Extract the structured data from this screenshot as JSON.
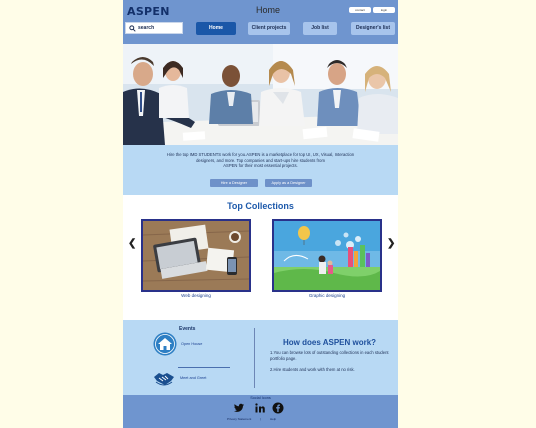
{
  "header": {
    "logo": "ASPEN",
    "title": "Home",
    "contact_label": "contact",
    "login_label": "login",
    "search_label": "search"
  },
  "nav": {
    "items": [
      {
        "label": "Home",
        "active": true
      },
      {
        "label": "Client projects",
        "active": false
      },
      {
        "label": "Job list",
        "active": false
      },
      {
        "label": "Designer's list",
        "active": false
      }
    ]
  },
  "intro": {
    "line1": "Hire the top IMD STUDENTS work for you.ASPEN is a marketplace for top UI, UX, Visual, Interaction",
    "line2": "designers, and more. Top companies and start-ups hire students from",
    "line3": "ASPEN for their most essential projects.",
    "hire_button": "Hire a Designer",
    "apply_button": "Apply as a Designer"
  },
  "collections": {
    "title": "Top Collections",
    "items": [
      {
        "label": "Web designing"
      },
      {
        "label": "Graphic designing"
      }
    ]
  },
  "events": {
    "title": "Events",
    "items": [
      {
        "label": "Open House",
        "icon": "house-icon"
      },
      {
        "label": "Meet and Greet",
        "icon": "handshake-icon"
      }
    ]
  },
  "how": {
    "title": "How does ASPEN work?",
    "step1": "1.You can browse lots of outstanding  collections in each student portfolio page.",
    "step2": "2.Hire students and work with them at no risk."
  },
  "footer": {
    "social_title": "Social Icons",
    "icons": [
      "twitter-icon",
      "linkedin-icon",
      "facebook-icon"
    ],
    "privacy": "Privacy Statement",
    "separator": "|",
    "help": "Help"
  },
  "colors": {
    "header": "#6f95cf",
    "nav_active": "#1a57a8",
    "nav_inactive": "#a7c4ec",
    "panel": "#b8d9f4",
    "accent": "#1e5aab",
    "frame": "#29318a",
    "background": "#fffde8"
  }
}
